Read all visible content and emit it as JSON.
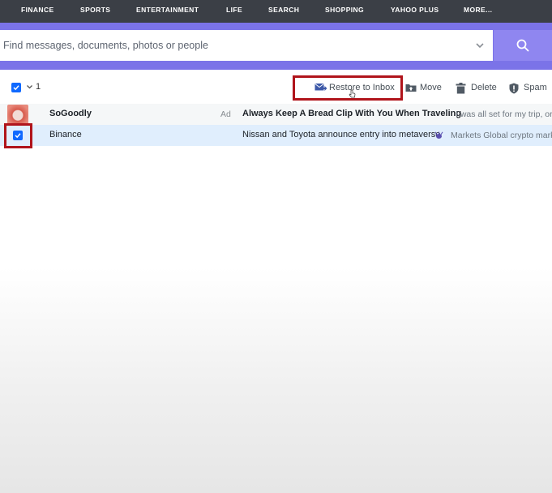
{
  "nav": {
    "items": [
      "FINANCE",
      "SPORTS",
      "ENTERTAINMENT",
      "LIFE",
      "SEARCH",
      "SHOPPING",
      "YAHOO PLUS",
      "MORE..."
    ]
  },
  "search": {
    "placeholder": "Find messages, documents, photos or people",
    "value": ""
  },
  "toolbar": {
    "selected_count": "1",
    "restore_label": "Restore to Inbox",
    "move_label": "Move",
    "delete_label": "Delete",
    "spam_label": "Spam"
  },
  "messages": [
    {
      "sender": "SoGoodly",
      "tag": "Ad",
      "subject": "Always Keep A Bread Clip With You When Traveling",
      "snippet": "I was all set for my trip, or"
    },
    {
      "sender": "Binance",
      "subject": "Nissan and Toyota announce entry into metaverse",
      "snippet": "Markets Global crypto mark"
    }
  ],
  "colors": {
    "nav_bg": "#3b3f46",
    "accent": "#7b73e8",
    "checkbox": "#0f69ff",
    "highlight": "#b0141b",
    "selected_row": "#e0eefd"
  }
}
